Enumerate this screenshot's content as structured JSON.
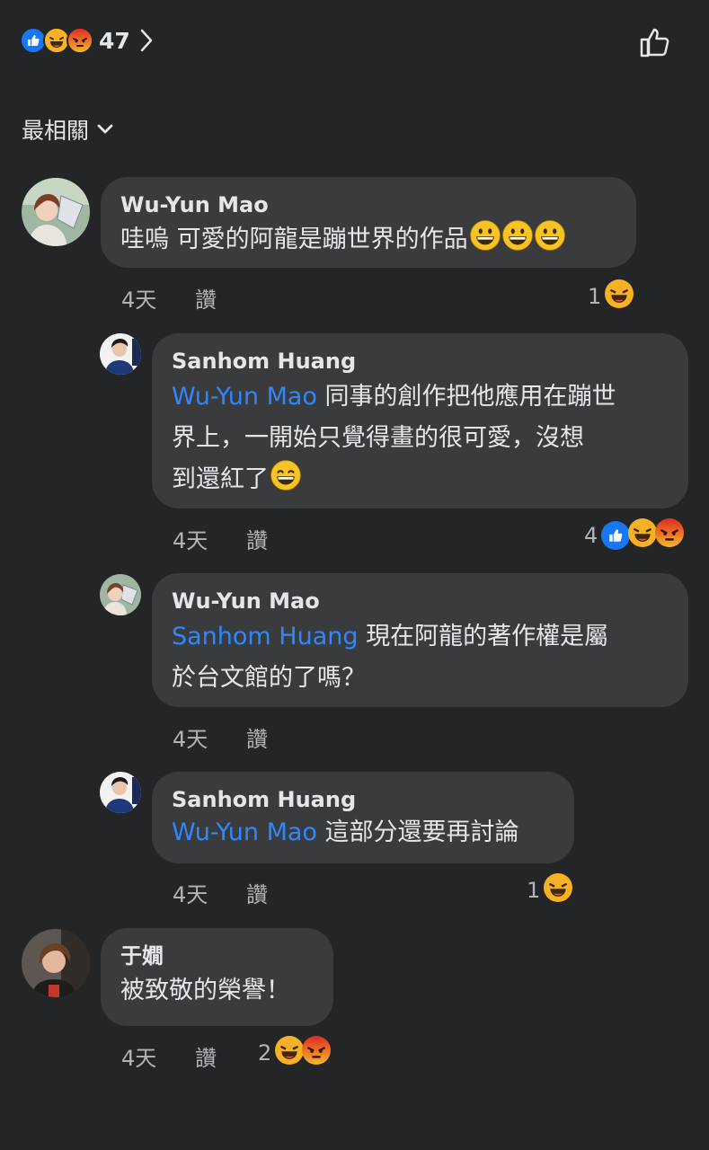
{
  "header": {
    "reactions": [
      "like-icon",
      "haha-icon",
      "angry-icon"
    ],
    "total_reactions": "47",
    "sort_label": "最相關"
  },
  "colors": {
    "background": "#242526",
    "bubble": "#3a3b3c",
    "mention": "#2d88ff",
    "like": "#1877f2",
    "haha": "#f7b125",
    "angry": "#e9710f"
  },
  "comments": [
    {
      "author": "Wu-Yun Mao",
      "text": "哇嗚 可愛的阿龍是蹦世界的作品",
      "emojis": [
        "grinning-face-icon",
        "grinning-face-icon",
        "grinning-face-icon"
      ],
      "time": "4天",
      "like_label": "讚",
      "reaction_count": "1",
      "reaction_icons": [
        "haha-icon"
      ]
    },
    {
      "author": "Sanhom Huang",
      "mention": "Wu-Yun Mao",
      "text_line1": " 同事的創作把他應用在蹦世",
      "text_line2": "界上，一開始只覺得畫的很可愛，沒想",
      "text_line3": "到還紅了",
      "emojis": [
        "smiling-face-icon"
      ],
      "time": "4天",
      "like_label": "讚",
      "reaction_count": "4",
      "reaction_icons": [
        "like-icon",
        "haha-icon",
        "angry-icon"
      ]
    },
    {
      "author": "Wu-Yun Mao",
      "mention": "Sanhom Huang",
      "text_line1": " 現在阿龍的著作權是屬",
      "text_line2": "於台文館的了嗎？",
      "time": "4天",
      "like_label": "讚"
    },
    {
      "author": "Sanhom Huang",
      "mention": "Wu-Yun Mao",
      "text": " 這部分還要再討論",
      "time": "4天",
      "like_label": "讚",
      "reaction_count": "1",
      "reaction_icons": [
        "haha-icon"
      ]
    },
    {
      "author": "于嫺",
      "text": "被致敬的榮譽！",
      "time": "4天",
      "like_label": "讚",
      "reaction_count": "2",
      "reaction_icons": [
        "haha-icon",
        "angry-icon"
      ]
    }
  ]
}
